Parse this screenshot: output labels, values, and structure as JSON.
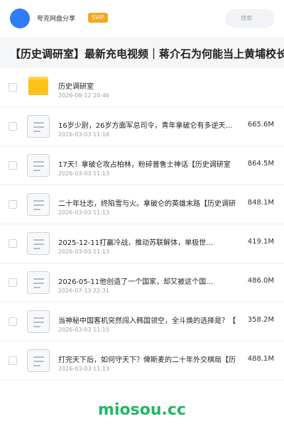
{
  "header": {
    "user_name": "夸克网盘分享",
    "badge": "SVIP",
    "search_placeholder": "搜索",
    "avatar_color": "#2e7cf6"
  },
  "share_title": "【历史调研室】最新充电视频｜蒋介石为何能当上黄埔校长",
  "files": [
    {
      "icon": "folder-icon",
      "name": "历史调研室",
      "date": "2026-08-12 20:46",
      "size": ""
    },
    {
      "icon": "video-file-icon",
      "name": "16岁少尉，26岁方面军总司令，青年拿破仑有多逆天…",
      "date": "2026-03-03 11:16",
      "size": "665.6M"
    },
    {
      "icon": "video-file-icon",
      "name": "17天！拿破仑攻占柏林，粉碎普鲁士神话【历史调研室",
      "date": "2026-03-03 11:13",
      "size": "864.5M"
    },
    {
      "icon": "video-file-icon",
      "name": "二十年壮志，终陷雪与火。拿破仑的英雄末路【历史调研",
      "date": "2026-03-03 11:13",
      "size": "848.1M"
    },
    {
      "icon": "video-file-icon",
      "name": "2025-12-11打赢冷战，推动苏联解体，单极世…",
      "date": "2026-03-03 11:13",
      "size": "419.1M"
    },
    {
      "icon": "video-file-icon",
      "name": "2026-05-11他创造了一个国家，却又被这个国…",
      "date": "2026-07-13 22:31",
      "size": "486.0M"
    },
    {
      "icon": "video-file-icon",
      "name": "当神秘中国客机突然闯入韩国领空，全斗焕的选择是？【",
      "date": "2026-03-03 11:15",
      "size": "358.2M"
    },
    {
      "icon": "video-file-icon",
      "name": "打完天下后，如何守天下？俾斯麦的二十年外交棋局【历",
      "date": "2026-03-03 11:13",
      "size": "488.1M"
    }
  ],
  "footer": {
    "brand": "miosou.cc",
    "brand_color": "#1fb864"
  }
}
